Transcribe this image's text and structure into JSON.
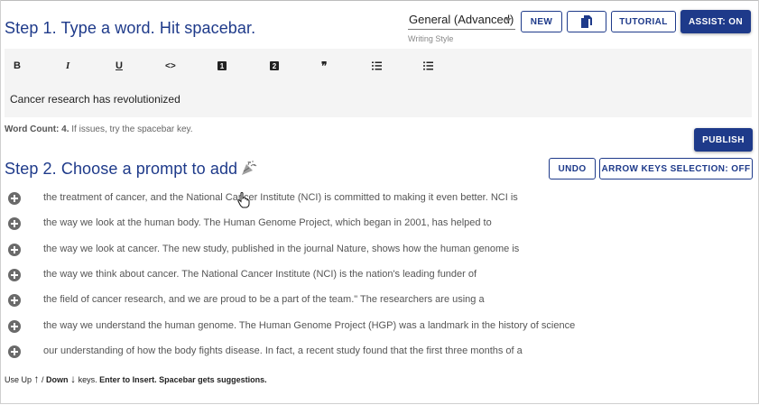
{
  "step1": {
    "title": "Step 1. Type a word. Hit spacebar."
  },
  "writing_style": {
    "value": "General (Advanced)",
    "caption": "Writing Style"
  },
  "buttons": {
    "new": "NEW",
    "tutorial": "TUTORIAL",
    "assist": "ASSIST: ON",
    "publish": "PUBLISH",
    "undo": "UNDO",
    "arrow_keys": "ARROW KEYS SELECTION: OFF"
  },
  "toolbar": {
    "bold": "B",
    "italic": "I",
    "underline": "U",
    "code": "<>",
    "heading1": "1",
    "heading2": "2",
    "quote": "❞",
    "numbered_list_icon": "numbered-list-icon",
    "bulleted_list_icon": "bulleted-list-icon"
  },
  "editor": {
    "text": "Cancer research has revolutionized"
  },
  "word_count": {
    "label": "Word Count: 4.",
    "hint": "If issues, try the spacebar key."
  },
  "step2": {
    "title": "Step 2. Choose a prompt to add"
  },
  "suggestions": [
    "the treatment of cancer, and the National Cancer Institute (NCI) is committed to making it even better. NCI is",
    "the way we look at the human body. The Human Genome Project, which began in 2001, has helped to",
    "the way we look at cancer. The new study, published in the journal Nature, shows how the human genome is",
    "the way we think about cancer. The National Cancer Institute (NCI) is the nation's leading funder of",
    "the field of cancer research, and we are proud to be a part of the team.\" The researchers are using a",
    "the way we understand the human genome. The Human Genome Project (HGP) was a landmark in the history of science",
    "our understanding of how the body fights disease. In fact, a recent study found that the first three months of a"
  ],
  "help": {
    "use": "Use Up",
    "up_arrow": "↑",
    "slash": " / ",
    "down": "Down",
    "down_arrow": "↓",
    "keys": "keys.",
    "enter": "Enter to Insert.",
    "space": "Spacebar gets suggestions."
  },
  "colors": {
    "primary": "#1e3a8a",
    "editor_bg": "#f4f4f4"
  }
}
